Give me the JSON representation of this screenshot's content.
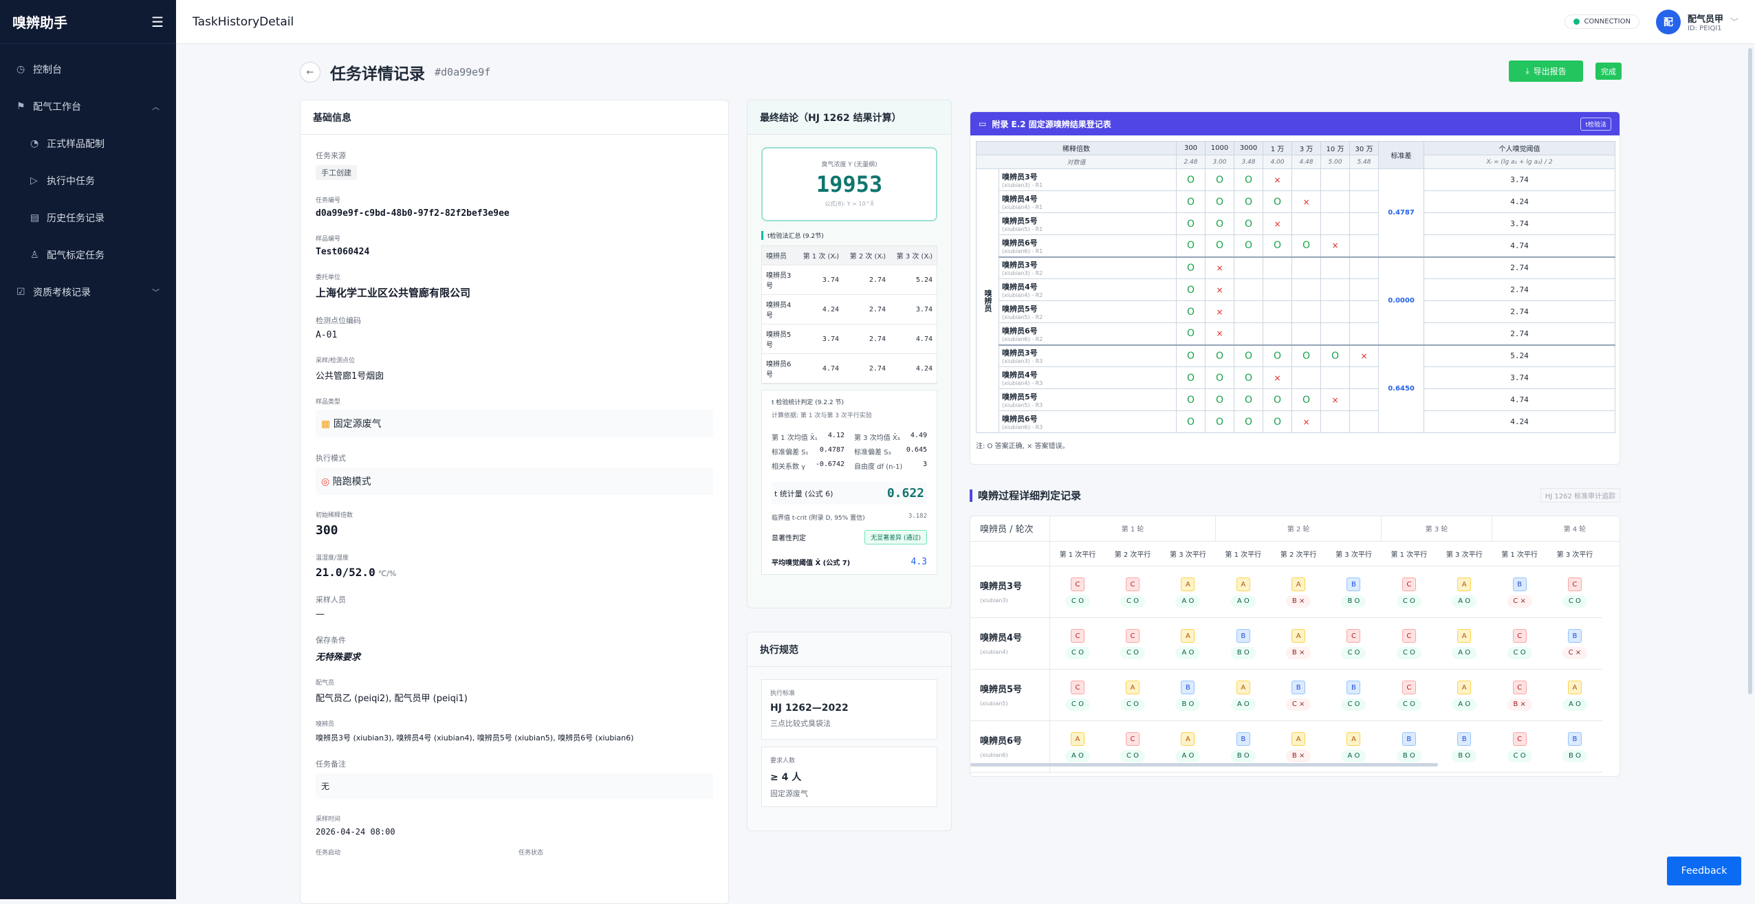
{
  "sidebar": {
    "brand": "嗅辨助手",
    "menu_icon": "menu-icon",
    "items": [
      {
        "label": "控制台",
        "icon": "dashboard-icon"
      },
      {
        "label": "配气工作台",
        "icon": "flag-icon"
      },
      {
        "label": "正式样品配制",
        "icon": "clock-icon"
      },
      {
        "label": "执行中任务",
        "icon": "play-icon"
      },
      {
        "label": "历史任务记录",
        "icon": "archive-icon"
      },
      {
        "label": "配气标定任务",
        "icon": "user-icon"
      },
      {
        "label": "资质考核记录",
        "icon": "checkbox-icon"
      }
    ]
  },
  "topbar": {
    "title": "TaskHistoryDetail",
    "connection": "CONNECTION",
    "user_avatar": "配",
    "user_name": "配气员甲",
    "user_id": "ID: PEIQI1"
  },
  "page": {
    "title": "任务详情记录",
    "task_hash": "#d0a99e9f",
    "export_label": "导出报告",
    "status_badge": "完成"
  },
  "basic": {
    "title": "基础信息",
    "source_label": "任务来源",
    "source_value": "手工创建",
    "task_no_label": "任务编号",
    "task_no": "d0a99e9f-c9bd-48b0-97f2-82f2bef3e9ee",
    "sample_no_label": "样品编号",
    "sample_no": "Test060424",
    "client_label": "委托单位",
    "client": "上海化学工业区公共管廊有限公司",
    "point_label": "检测点位编码",
    "point": "A-01",
    "site_label": "采样/检测点位",
    "site": "公共管廊1号烟囱",
    "sample_type_label": "样品类型",
    "sample_type": "固定源废气",
    "exec_mode_label": "执行模式",
    "exec_mode": "陪跑模式",
    "dilution_label": "初始稀释倍数",
    "dilution": "300",
    "temp_label": "温湿度/湿度",
    "temp": "21.0/52.0",
    "temp_unit": "℃/%",
    "sampler_label": "采样人员",
    "sampler": "—",
    "storage_label": "保存条件",
    "storage": "无特殊要求",
    "gas_label": "配气员",
    "gas": "配气员乙 (peiqi2), 配气员甲 (peiqi1)",
    "sniffers_label": "嗅辨员",
    "sniffers": "嗅辨员3号 (xiubian3), 嗅辨员4号 (xiubian4), 嗅辨员5号 (xiubian5), 嗅辨员6号 (xiubian6)",
    "remark_label": "任务备注",
    "remark": "无",
    "sampling_time_label": "采样时间",
    "sampling_time": "2026-04-24 08:00",
    "start_label": "任务启动",
    "status_label": "任务状态"
  },
  "conclusion": {
    "title": "最终结论（HJ 1262 结果计算）",
    "conc_label": "臭气浓度 Y (无量纲)",
    "conc_value": "19953",
    "formula": "公式(8): Y = 10^X̄",
    "ttest_title": "t检验法汇总 (9.2节)",
    "ttest_headers": [
      "嗅辨员",
      "第 1 次 (Xᵢ)",
      "第 2 次 (Xᵢ)",
      "第 3 次 (Xᵢ)"
    ],
    "ttest_rows": [
      [
        "嗅辨员3号",
        "3.74",
        "2.74",
        "5.24"
      ],
      [
        "嗅辨员4号",
        "4.24",
        "2.74",
        "3.74"
      ],
      [
        "嗅辨员5号",
        "3.74",
        "2.74",
        "4.74"
      ],
      [
        "嗅辨员6号",
        "4.74",
        "2.74",
        "4.24"
      ]
    ],
    "stat_title": "t 检验统计判定 (9.2.2 节)",
    "stat_basis": "计算依据: 第 1 次与第 3 次平行实验",
    "mean1_label": "第 1 次均值 X̄₁",
    "mean1": "4.12",
    "mean3_label": "第 3 次均值 X̄₃",
    "mean3": "4.49",
    "sd1_label": "标准偏差 S₁",
    "sd1": "0.4787",
    "sd3_label": "标准偏差 S₃",
    "sd3": "0.645",
    "r_label": "相关系数 γ",
    "r": "-0.6742",
    "df_label": "自由度 df (n-1)",
    "df": "3",
    "t_label": "t 统计量 (公式 6)",
    "t_value": "0.622",
    "tcrit_label": "临界值 t-crit (附录 D, 95% 置信)",
    "tcrit": "3.182",
    "sig_label": "显著性判定",
    "sig_value": "无显著差异 (通过)",
    "avg_label": "平均嗅觉阈值 X̄ (公式 7)",
    "avg_value": "4.3"
  },
  "spec": {
    "title": "执行规范",
    "std_label": "执行标准",
    "std_value": "HJ 1262—2022",
    "std_desc": "三点比较式臭袋法",
    "req_label": "要求人数",
    "req_value": "≥ 4 人",
    "req_desc": "固定源废气"
  },
  "register": {
    "title": "附录 E.2 固定源嗅辨结果登记表",
    "tag": "t检验法",
    "head_dilution": "稀释倍数",
    "head_log": "对数值",
    "head_std": "标准差",
    "head_indiv": "个人嗅觉阈值",
    "indiv_formula": "Xᵢ = (lg a₁ + lg a₂) / 2",
    "dilutions": [
      "300",
      "1000",
      "3000",
      "1 万",
      "3 万",
      "10 万",
      "30 万"
    ],
    "logs": [
      "2.48",
      "3.00",
      "3.48",
      "4.00",
      "4.48",
      "5.00",
      "5.48"
    ],
    "group_label": "嗅辨员",
    "rounds": [
      {
        "sd": "0.4787",
        "rows": [
          {
            "name": "嗅辨员3号",
            "id": "(xiubian3) - R1",
            "cells": [
              "o",
              "o",
              "o",
              "x",
              "",
              "",
              ""
            ],
            "xi": "3.74"
          },
          {
            "name": "嗅辨员4号",
            "id": "(xiubian4) - R1",
            "cells": [
              "o",
              "o",
              "o",
              "o",
              "x",
              "",
              ""
            ],
            "xi": "4.24"
          },
          {
            "name": "嗅辨员5号",
            "id": "(xiubian5) - R1",
            "cells": [
              "o",
              "o",
              "o",
              "x",
              "",
              "",
              ""
            ],
            "xi": "3.74"
          },
          {
            "name": "嗅辨员6号",
            "id": "(xiubian6) - R1",
            "cells": [
              "o",
              "o",
              "o",
              "o",
              "o",
              "x",
              ""
            ],
            "xi": "4.74"
          }
        ]
      },
      {
        "sd": "0.0000",
        "rows": [
          {
            "name": "嗅辨员3号",
            "id": "(xiubian3) - R2",
            "cells": [
              "o",
              "x",
              "",
              "",
              "",
              "",
              ""
            ],
            "xi": "2.74"
          },
          {
            "name": "嗅辨员4号",
            "id": "(xiubian4) - R2",
            "cells": [
              "o",
              "x",
              "",
              "",
              "",
              "",
              ""
            ],
            "xi": "2.74"
          },
          {
            "name": "嗅辨员5号",
            "id": "(xiubian5) - R2",
            "cells": [
              "o",
              "x",
              "",
              "",
              "",
              "",
              ""
            ],
            "xi": "2.74"
          },
          {
            "name": "嗅辨员6号",
            "id": "(xiubian6) - R2",
            "cells": [
              "o",
              "x",
              "",
              "",
              "",
              "",
              ""
            ],
            "xi": "2.74"
          }
        ]
      },
      {
        "sd": "0.6450",
        "rows": [
          {
            "name": "嗅辨员3号",
            "id": "(xiubian3) - R3",
            "cells": [
              "o",
              "o",
              "o",
              "o",
              "o",
              "o",
              "x"
            ],
            "xi": "5.24"
          },
          {
            "name": "嗅辨员4号",
            "id": "(xiubian4) - R3",
            "cells": [
              "o",
              "o",
              "o",
              "x",
              "",
              "",
              ""
            ],
            "xi": "3.74"
          },
          {
            "name": "嗅辨员5号",
            "id": "(xiubian5) - R3",
            "cells": [
              "o",
              "o",
              "o",
              "o",
              "o",
              "x",
              ""
            ],
            "xi": "4.74"
          },
          {
            "name": "嗅辨员6号",
            "id": "(xiubian6) - R3",
            "cells": [
              "o",
              "o",
              "o",
              "o",
              "x",
              "",
              ""
            ],
            "xi": "4.24"
          }
        ]
      }
    ],
    "note": "注: O 答案正确, × 答案错误。"
  },
  "judge": {
    "title": "嗅辨过程详细判定记录",
    "tag": "HJ 1262 标准审计追踪",
    "corner": "嗅辨员 / 轮次",
    "round_labels": [
      "第 1 轮",
      "第 2 轮",
      "第 3 轮",
      "第 4 轮"
    ],
    "sub_labels": [
      "第 1 次平行",
      "第 2 次平行",
      "第 3 次平行",
      "第 1 次平行",
      "第 2 次平行",
      "第 3 次平行",
      "第 1 次平行",
      "第 3 次平行",
      "第 1 次平行",
      "第 3 次平行",
      "第"
    ],
    "rows": [
      {
        "name": "嗅辨员3号",
        "id": "(xiubian3)",
        "cells": [
          [
            "C",
            "C",
            "y"
          ],
          [
            "C",
            "C",
            "y"
          ],
          [
            "A",
            "A",
            "y"
          ],
          [
            "A",
            "A",
            "y"
          ],
          [
            "A",
            "B",
            "n"
          ],
          [
            "B",
            "B",
            "y"
          ],
          [
            "C",
            "C",
            "y"
          ],
          [
            "A",
            "A",
            "y"
          ],
          [
            "B",
            "C",
            "n"
          ],
          [
            "C",
            "C",
            "y"
          ]
        ]
      },
      {
        "name": "嗅辨员4号",
        "id": "(xiubian4)",
        "cells": [
          [
            "C",
            "C",
            "y"
          ],
          [
            "C",
            "C",
            "y"
          ],
          [
            "A",
            "A",
            "y"
          ],
          [
            "B",
            "B",
            "y"
          ],
          [
            "A",
            "B",
            "n"
          ],
          [
            "C",
            "C",
            "y"
          ],
          [
            "C",
            "C",
            "y"
          ],
          [
            "A",
            "A",
            "y"
          ],
          [
            "C",
            "C",
            "y"
          ],
          [
            "B",
            "C",
            "n"
          ]
        ]
      },
      {
        "name": "嗅辨员5号",
        "id": "(xiubian5)",
        "cells": [
          [
            "C",
            "C",
            "y"
          ],
          [
            "A",
            "C",
            "y"
          ],
          [
            "B",
            "B",
            "y"
          ],
          [
            "A",
            "A",
            "y"
          ],
          [
            "B",
            "C",
            "n"
          ],
          [
            "B",
            "C",
            "y"
          ],
          [
            "C",
            "C",
            "y"
          ],
          [
            "A",
            "A",
            "y"
          ],
          [
            "C",
            "B",
            "n"
          ],
          [
            "A",
            "A",
            "y"
          ]
        ]
      },
      {
        "name": "嗅辨员6号",
        "id": "(xiubian6)",
        "cells": [
          [
            "A",
            "A",
            "y"
          ],
          [
            "C",
            "C",
            "y"
          ],
          [
            "A",
            "A",
            "y"
          ],
          [
            "B",
            "B",
            "y"
          ],
          [
            "A",
            "B",
            "n"
          ],
          [
            "A",
            "A",
            "y"
          ],
          [
            "B",
            "B",
            "y"
          ],
          [
            "B",
            "B",
            "y"
          ],
          [
            "C",
            "C",
            "y"
          ],
          [
            "B",
            "B",
            "y"
          ]
        ]
      }
    ]
  },
  "feedback": "Feedback"
}
